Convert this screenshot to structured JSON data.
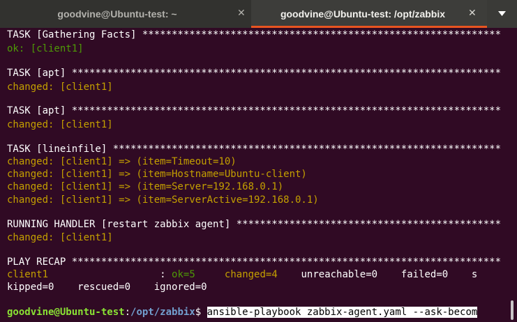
{
  "tabs": [
    {
      "label": "goodvine@Ubuntu-test: ~",
      "close": "✕",
      "active": false
    },
    {
      "label": "goodvine@Ubuntu-test: /opt/zabbix",
      "close": "✕",
      "active": true
    }
  ],
  "tabs_menu_icon": "chevron-down-icon",
  "colors": {
    "background": "#300a24",
    "ok": "#4e9a06",
    "changed": "#c4a000",
    "prompt_user": "#8ae234",
    "prompt_path": "#729fcf",
    "active_tab_accent": "#e95420"
  },
  "terminal": {
    "lines": [
      "TASK [Gathering Facts] *************************************************************",
      "ok: [client1]",
      "TASK [apt] *************************************************************************",
      "changed: [client1]",
      "TASK [apt] *************************************************************************",
      "changed: [client1]",
      "TASK [lineinfile] ******************************************************************",
      "changed: [client1] => (item=Timeout=10)",
      "changed: [client1] => (item=Hostname=Ubuntu-client)",
      "changed: [client1] => (item=Server=192.168.0.1)",
      "changed: [client1] => (item=ServerActive=192.168.0.1)",
      "RUNNING HANDLER [restart zabbix agent] *********************************************",
      "changed: [client1]",
      "PLAY RECAP *************************************************************************"
    ],
    "recap": {
      "host": "client1",
      "sep": "                   : ",
      "ok": "ok=5",
      "changed": "changed=4",
      "rest1": "unreachable=0    failed=0    s",
      "rest2": "kipped=0    rescued=0    ignored=0"
    },
    "prompt": {
      "user_host": "goodvine@Ubuntu-test",
      "colon": ":",
      "path": "/opt/zabbix",
      "dollar": "$ ",
      "command": "ansible-playbook zabbix-agent.yaml --ask-becom"
    }
  }
}
